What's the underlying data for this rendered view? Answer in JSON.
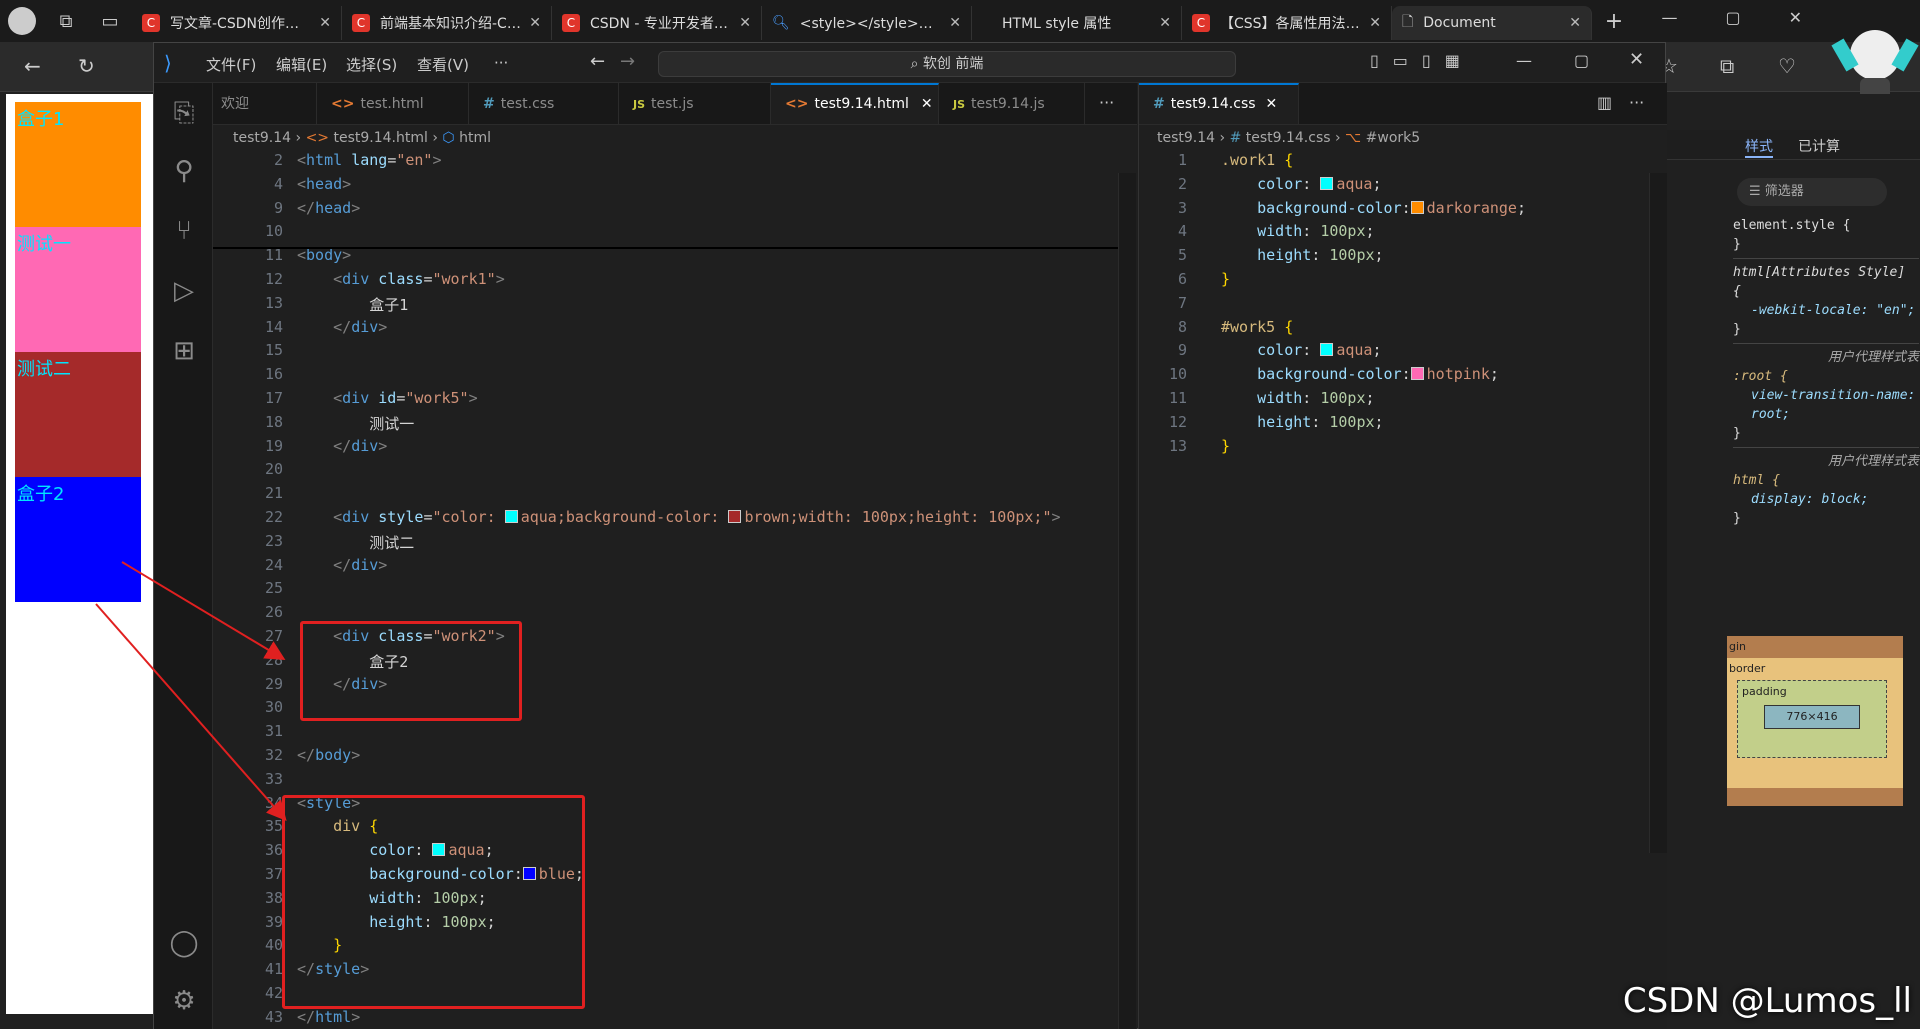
{
  "browser": {
    "tabs": [
      {
        "title": "写文章-CSDN创作中心",
        "icon": "csdn-icon"
      },
      {
        "title": "前端基本知识介绍-CSDN",
        "icon": "csdn-icon"
      },
      {
        "title": "CSDN - 专业开发者社区",
        "icon": "csdn-icon"
      },
      {
        "title": "<style></style>属性",
        "icon": "search-icon"
      },
      {
        "title": "HTML style 属性",
        "icon": "page-icon"
      },
      {
        "title": "【CSS】各属性用法汇总",
        "icon": "csdn-icon"
      },
      {
        "title": "Document",
        "icon": "document-icon"
      }
    ],
    "new_tab": "+"
  },
  "page_preview": {
    "boxes": [
      {
        "text": "盒子1",
        "color": "#00ffff",
        "bg": "#ff8c00"
      },
      {
        "text": "测试一",
        "color": "#00ffff",
        "bg": "#ff69b4"
      },
      {
        "text": "测试二",
        "color": "#00ffff",
        "bg": "#a52a2a"
      },
      {
        "text": "盒子2",
        "color": "#00ffff",
        "bg": "#0000ff"
      }
    ]
  },
  "vscode": {
    "menu": [
      "文件(F)",
      "编辑(E)",
      "选择(S)",
      "查看(V)",
      "···"
    ],
    "search": "软创 前端",
    "left_tabs": [
      {
        "label": "欢迎",
        "icon": ""
      },
      {
        "label": "test.html",
        "icon": "<>"
      },
      {
        "label": "test.css",
        "icon": "#"
      },
      {
        "label": "test.js",
        "icon": "JS"
      },
      {
        "label": "test9.14.html",
        "icon": "<>"
      },
      {
        "label": "test9.14.js",
        "icon": "JS"
      }
    ],
    "left_breadcrumb": [
      "test9.14",
      "test9.14.html",
      "html"
    ],
    "right_tab": {
      "label": "test9.14.css",
      "icon": "#"
    },
    "right_breadcrumb": [
      "test9.14",
      "test9.14.css",
      "#work5"
    ]
  },
  "devtools": {
    "tabs": [
      "样式",
      "已计算"
    ],
    "filter": "筛选器",
    "rules": [
      "element.style {",
      "}",
      "html[Attributes Style] {",
      "-webkit-locale: \"en\";",
      "}",
      "用户代理样式表",
      ":root {",
      "view-transition-name: root;",
      "}",
      "用户代理样式表",
      "html {",
      "display: block;",
      "}"
    ],
    "box_model": {
      "margin": "gin",
      "border": "border",
      "padding": "padding",
      "size": "776×416",
      "dash": "–"
    }
  },
  "watermark": "CSDN @Lumos_ll"
}
